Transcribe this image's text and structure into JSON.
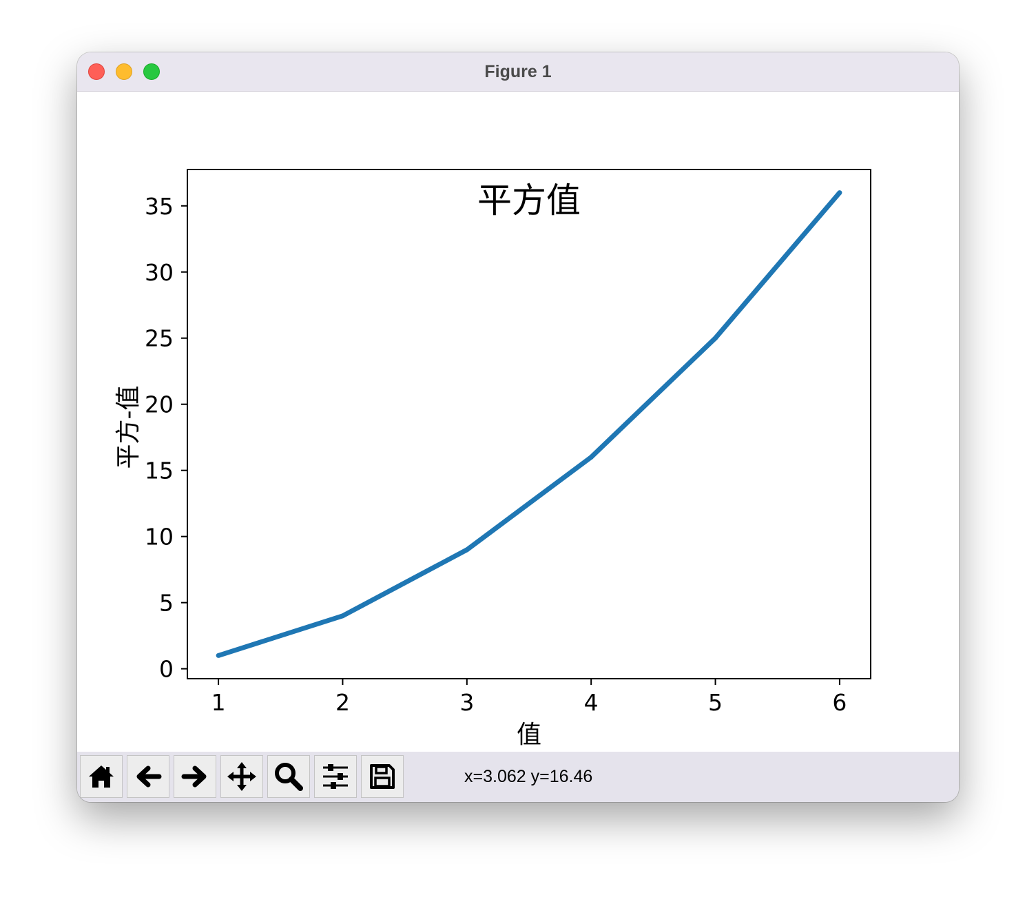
{
  "window": {
    "title": "Figure 1"
  },
  "toolbar": {
    "buttons": [
      {
        "name": "home-button",
        "icon": "home-icon"
      },
      {
        "name": "back-button",
        "icon": "arrow-left-icon"
      },
      {
        "name": "forward-button",
        "icon": "arrow-right-icon"
      },
      {
        "name": "pan-button",
        "icon": "move-icon"
      },
      {
        "name": "zoom-button",
        "icon": "magnifier-icon"
      },
      {
        "name": "configure-subplots-button",
        "icon": "sliders-icon"
      },
      {
        "name": "save-button",
        "icon": "floppy-disk-icon"
      }
    ],
    "coords": "x=3.062 y=16.46"
  },
  "colors": {
    "line": "#1f77b4",
    "titlebar": "#e9e6ef",
    "toolbar": "#e5e3ec"
  },
  "chart_data": {
    "type": "line",
    "title": "平方值",
    "xlabel": "值",
    "ylabel": "平方-值",
    "x": [
      1,
      2,
      3,
      4,
      5,
      6
    ],
    "series": [
      {
        "values": [
          1,
          4,
          9,
          16,
          25,
          36
        ]
      }
    ],
    "xticks": [
      "1",
      "2",
      "3",
      "4",
      "5",
      "6"
    ],
    "yticks": [
      "0",
      "5",
      "10",
      "15",
      "20",
      "25",
      "30",
      "35"
    ],
    "xlim": [
      0.75,
      6.25
    ],
    "ylim": [
      -0.75,
      37.75
    ],
    "grid": false
  }
}
